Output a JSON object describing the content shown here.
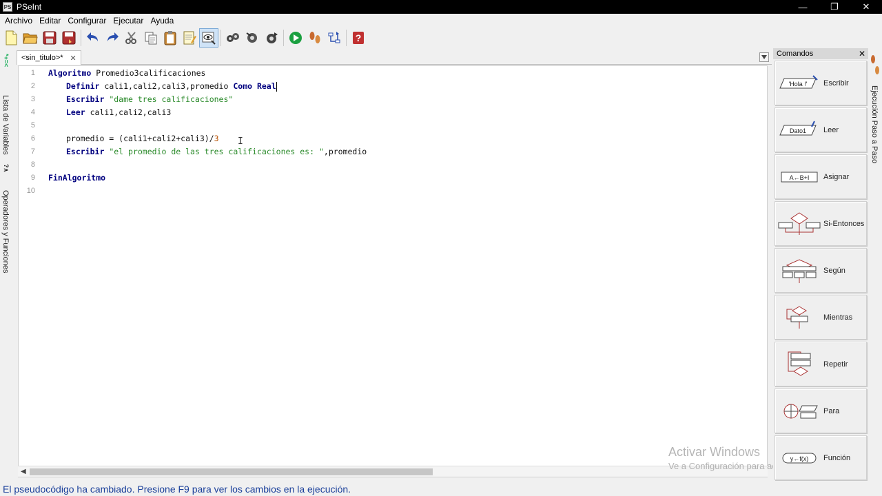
{
  "window": {
    "title": "PSeInt",
    "app_icon_text": "PS",
    "buttons": {
      "minimize": "—",
      "maximize": "❐",
      "close": "✕"
    }
  },
  "menubar": {
    "items": [
      "Archivo",
      "Editar",
      "Configurar",
      "Ejecutar",
      "Ayuda"
    ]
  },
  "sidebar_left": {
    "variables_tab": "Lista de Variables",
    "variables_icon_text": "*+=<",
    "operators_tab": "Operadores y Funciones",
    "operators_icon_text": "?∧"
  },
  "tab": {
    "label": "<sin_titulo>*",
    "close": "✕"
  },
  "editor": {
    "lines": [
      {
        "n": "1",
        "kw1": "Algoritmo",
        "rest": " Promedio3calificaciones"
      },
      {
        "n": "2",
        "kw1": "Definir",
        "mid": " cali1,cali2,cali3,promedio ",
        "kw2": "Como Real"
      },
      {
        "n": "3",
        "kw1": "Escribir",
        "str": " \"dame tres calificaciones\""
      },
      {
        "n": "4",
        "kw1": "Leer",
        "rest": " cali1,cali2,cali3"
      },
      {
        "n": "5"
      },
      {
        "n": "6",
        "pre": "promedio = (cali1+cali2+cali3)/",
        "num": "3"
      },
      {
        "n": "7",
        "kw1": "Escribir",
        "str": " \"el promedio de las tres calificaciones es: \"",
        "rest": ",promedio"
      },
      {
        "n": "8"
      },
      {
        "n": "9",
        "kw1": "FinAlgoritmo"
      },
      {
        "n": "10"
      }
    ]
  },
  "watermark": {
    "title": "Activar Windows",
    "subtitle": "Ve a Configuración para activar Windows."
  },
  "commands": {
    "header": "Comandos",
    "close": "✕",
    "items": [
      {
        "label": "Escribir",
        "icon_text": "'Hola !'"
      },
      {
        "label": "Leer",
        "icon_text": "Dato1"
      },
      {
        "label": "Asignar",
        "icon_text": "A←B+I"
      },
      {
        "label": "Si-Entonces",
        "icon_text": ""
      },
      {
        "label": "Según",
        "icon_text": ""
      },
      {
        "label": "Mientras",
        "icon_text": ""
      },
      {
        "label": "Repetir",
        "icon_text": ""
      },
      {
        "label": "Para",
        "icon_text": ""
      },
      {
        "label": "Función",
        "icon_text": "y←f(x)"
      }
    ]
  },
  "sidebar_right": {
    "step_tab": "Ejecución Paso a Paso"
  },
  "status": {
    "message": "El pseudocódigo ha cambiado. Presione F9 para ver los cambios en la ejecución."
  },
  "colors": {
    "keyword": "#00007f",
    "string": "#2a8a2a",
    "number": "#b85000",
    "status_text": "#1a3f9a"
  }
}
